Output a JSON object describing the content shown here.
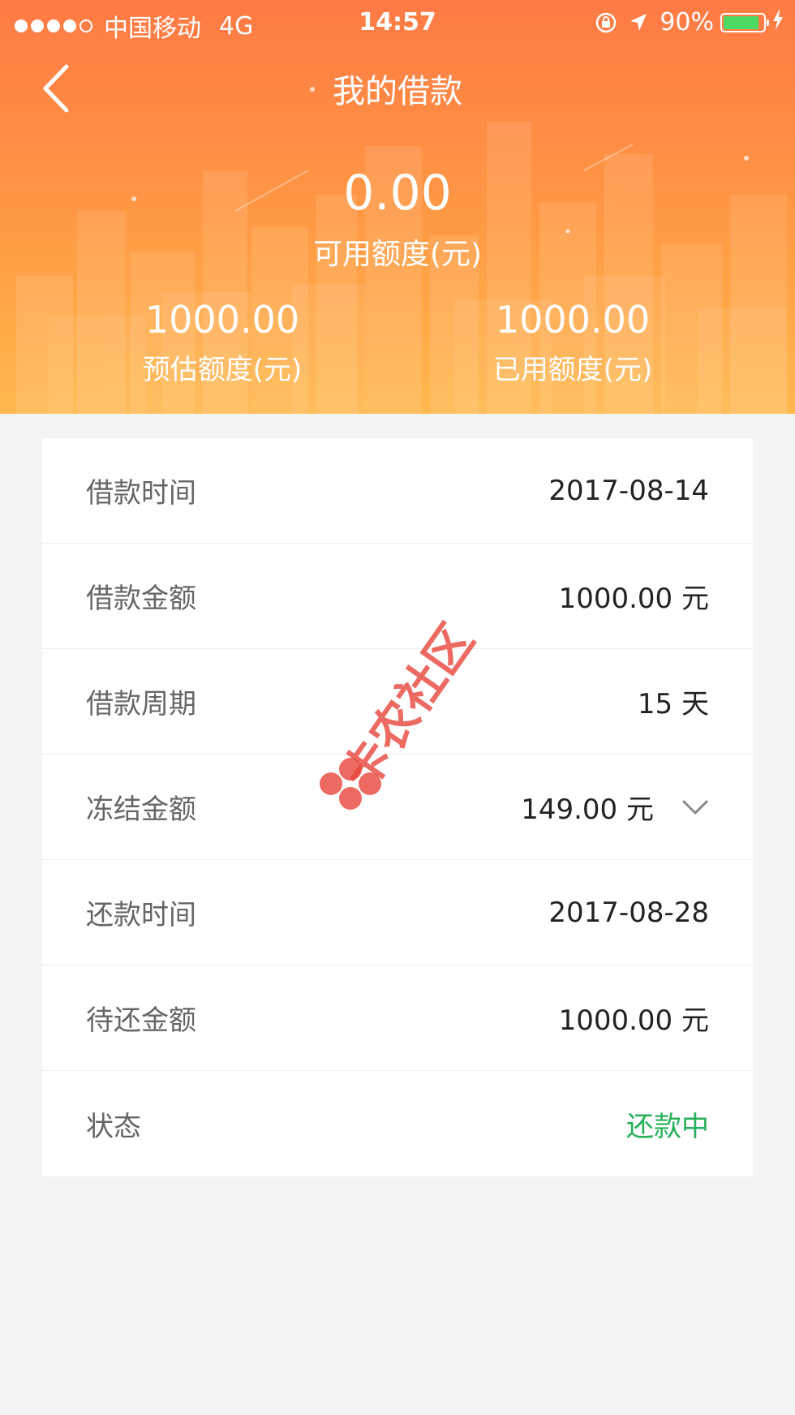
{
  "status_bar": {
    "carrier": "中国移动",
    "network": "4G",
    "time": "14:57",
    "battery_percent": "90%",
    "battery_level": 0.9,
    "signal_bars_filled": 4,
    "signal_bars_total": 5
  },
  "header": {
    "title": "我的借款",
    "back_icon": "chevron-left-icon",
    "available_amount": "0.00",
    "available_label": "可用额度(元)",
    "estimated_amount": "1000.00",
    "estimated_label": "预估额度(元)",
    "used_amount": "1000.00",
    "used_label": "已用额度(元)"
  },
  "details": {
    "loan_date_label": "借款时间",
    "loan_date": "2017-08-14",
    "loan_amount_label": "借款金额",
    "loan_amount": "1000.00 元",
    "loan_period_label": "借款周期",
    "loan_period": "15 天",
    "frozen_amount_label": "冻结金额",
    "frozen_amount": "149.00 元",
    "repay_date_label": "还款时间",
    "repay_date": "2017-08-28",
    "pending_amount_label": "待还金额",
    "pending_amount": "1000.00 元",
    "status_label": "状态",
    "status_value": "还款中"
  },
  "colors": {
    "header_top": "#ff7a45",
    "header_bottom": "#ffb84e",
    "status_green": "#25b05a",
    "label_gray": "#666666",
    "value_dark": "#222222",
    "watermark_red": "#e8453c"
  },
  "watermark": {
    "text": "卡农社区"
  }
}
